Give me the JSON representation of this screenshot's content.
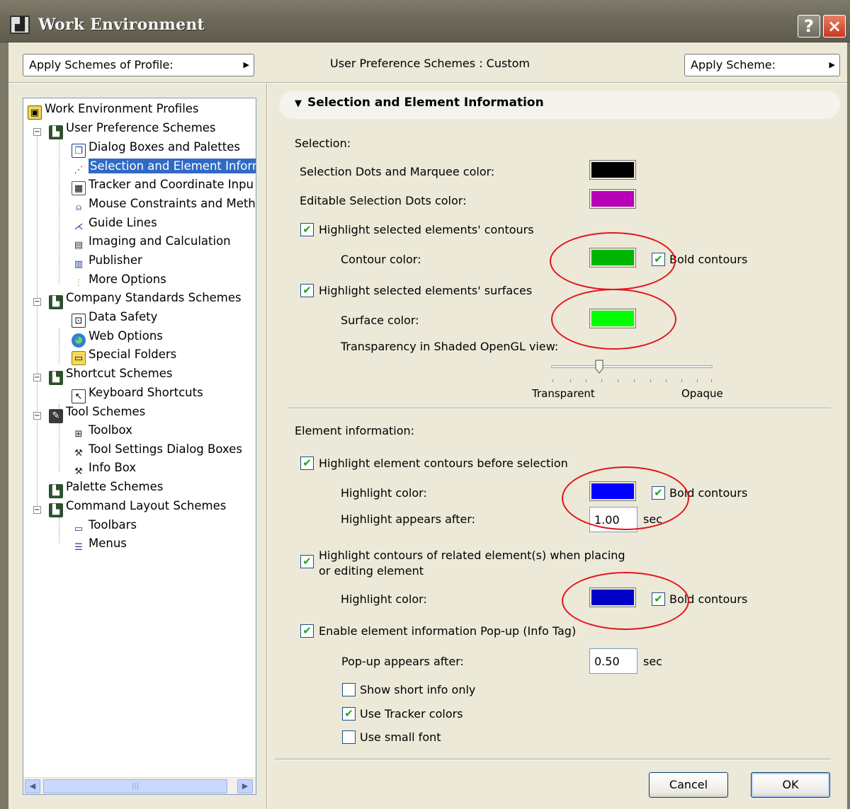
{
  "window": {
    "title": "Work Environment",
    "help_label": "?",
    "close_label": "×"
  },
  "toolbar": {
    "profile_button": "Apply Schemes of Profile:",
    "scheme_status": "User Preference Schemes : Custom",
    "scheme_button": "Apply Scheme:",
    "dropdown_arrow": "▶"
  },
  "tree": {
    "items": [
      {
        "label": "Work Environment Profiles",
        "icon": "profiles-icon"
      },
      {
        "label": "User Preference Schemes",
        "icon": "user-schemes-icon"
      },
      {
        "label": "Dialog Boxes and Palettes",
        "icon": "dialog-palettes-icon"
      },
      {
        "label": "Selection and Element Inforr",
        "icon": "selection-info-icon"
      },
      {
        "label": "Tracker and Coordinate Inpu",
        "icon": "tracker-icon"
      },
      {
        "label": "Mouse Constraints and Meth",
        "icon": "mouse-icon"
      },
      {
        "label": "Guide Lines",
        "icon": "guide-lines-icon"
      },
      {
        "label": "Imaging and Calculation",
        "icon": "imaging-icon"
      },
      {
        "label": "Publisher",
        "icon": "publisher-icon"
      },
      {
        "label": "More Options",
        "icon": "more-options-icon"
      },
      {
        "label": "Company Standards Schemes",
        "icon": "company-schemes-icon"
      },
      {
        "label": "Data Safety",
        "icon": "data-safety-icon"
      },
      {
        "label": "Web Options",
        "icon": "web-options-icon"
      },
      {
        "label": "Special Folders",
        "icon": "special-folders-icon"
      },
      {
        "label": "Shortcut Schemes",
        "icon": "shortcut-schemes-icon"
      },
      {
        "label": "Keyboard Shortcuts",
        "icon": "keyboard-shortcuts-icon"
      },
      {
        "label": "Tool Schemes",
        "icon": "tool-schemes-icon"
      },
      {
        "label": "Toolbox",
        "icon": "toolbox-icon"
      },
      {
        "label": "Tool Settings Dialog Boxes",
        "icon": "tool-settings-icon"
      },
      {
        "label": "Info Box",
        "icon": "info-box-icon"
      },
      {
        "label": "Palette Schemes",
        "icon": "palette-schemes-icon"
      },
      {
        "label": "Command Layout Schemes",
        "icon": "command-layout-icon"
      },
      {
        "label": "Toolbars",
        "icon": "toolbars-icon"
      },
      {
        "label": "Menus",
        "icon": "menus-icon"
      }
    ],
    "selected": "Selection and Element Inforr"
  },
  "panel": {
    "section_title": "Selection and Element Information",
    "selection": {
      "heading": "Selection:",
      "dots_label": "Selection Dots and Marquee color:",
      "dots_color": "#000000",
      "editable_label": "Editable Selection Dots color:",
      "editable_color": "#b700b7",
      "highlight_contours_label": "Highlight selected elements' contours",
      "highlight_contours_checked": true,
      "contour_color_label": "Contour color:",
      "contour_color": "#00b500",
      "bold_contours_label": "Bold contours",
      "bold_contours_checked": true,
      "highlight_surfaces_label": "Highlight selected elements' surfaces",
      "highlight_surfaces_checked": true,
      "surface_color_label": "Surface color:",
      "surface_color": "#00ff00",
      "transparency_label": "Transparency in Shaded OpenGL view:",
      "transparency_value": 0.3,
      "slider_min_label": "Transparent",
      "slider_max_label": "Opaque"
    },
    "element_info": {
      "heading": "Element information:",
      "highlight_before_label": "Highlight element contours before selection",
      "highlight_before_checked": true,
      "highlight_color_label": "Highlight color:",
      "highlight_color": "#0000ff",
      "bold1_label": "Bold contours",
      "bold1_checked": true,
      "appears_after_label": "Highlight appears after:",
      "appears_after_value": "1.00",
      "appears_after_unit": "sec",
      "related_line1": "Highlight contours of related element(s) when placing",
      "related_line2": "or editing element",
      "related_checked": true,
      "related_color_label": "Highlight color:",
      "related_color": "#0000c8",
      "bold2_label": "Bold contours",
      "bold2_checked": true,
      "popup_enable_label": "Enable element information Pop-up (Info Tag)",
      "popup_enable_checked": true,
      "popup_after_label": "Pop-up appears after:",
      "popup_after_value": "0.50",
      "popup_after_unit": "sec",
      "short_info_label": "Show short info only",
      "short_info_checked": false,
      "tracker_colors_label": "Use Tracker colors",
      "tracker_colors_checked": true,
      "small_font_label": "Use small font",
      "small_font_checked": false
    }
  },
  "buttons": {
    "cancel": "Cancel",
    "ok": "OK"
  },
  "checkmark": "✔",
  "annotation_color": "#e3131b"
}
